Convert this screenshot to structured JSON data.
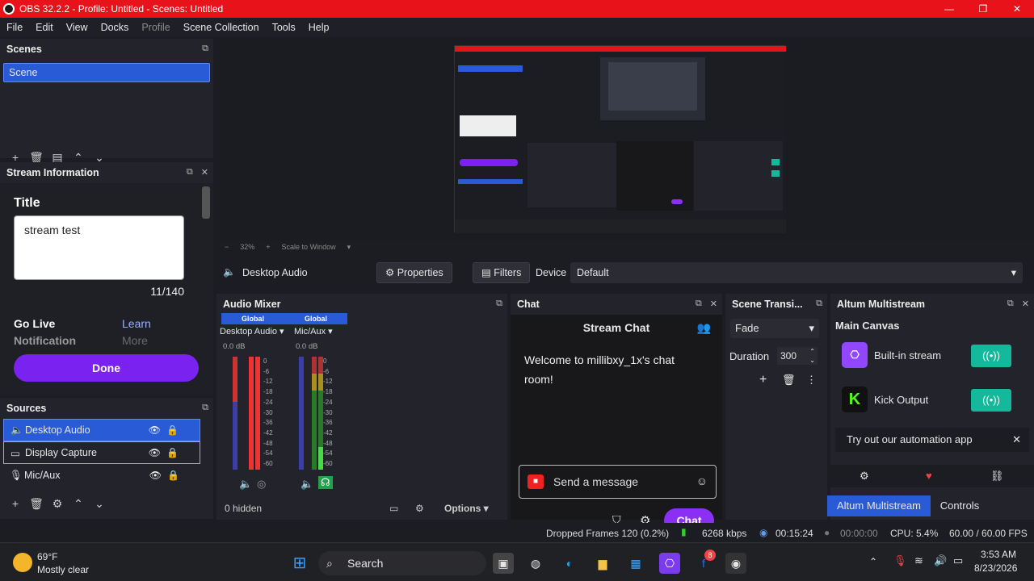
{
  "window": {
    "title": "OBS 32.2.2 - Profile: Untitled - Scenes: Untitled",
    "controls": [
      "—",
      "❐",
      "✕"
    ]
  },
  "menu": [
    "File",
    "Edit",
    "View",
    "Docks",
    "Profile",
    "Scene Collection",
    "Tools",
    "Help"
  ],
  "scenes": {
    "title": "Scenes",
    "items": [
      "Scene"
    ]
  },
  "stream_info": {
    "title": "Stream Information",
    "field_label": "Title",
    "field_value": "stream test",
    "counter": "11/140",
    "go_live_line1": "Go Live",
    "go_live_line2": "Notification",
    "learn_line1": "Learn",
    "learn_line2": "More",
    "done": "Done"
  },
  "sources": {
    "title": "Sources",
    "items": [
      {
        "label": "Desktop Audio"
      },
      {
        "label": "Display Capture"
      },
      {
        "label": "Mic/Aux"
      }
    ]
  },
  "preview": {
    "zoom": "32%",
    "scale": "Scale to Window"
  },
  "controls": {
    "source_name": "Desktop Audio",
    "properties": "Properties",
    "filters": "Filters",
    "device_label": "Device",
    "device_value": "Default"
  },
  "mixer": {
    "title": "Audio Mixer",
    "channels": [
      {
        "badge": "Global",
        "name": "Desktop Audio",
        "db": "0.0 dB"
      },
      {
        "badge": "Global",
        "name": "Mic/Aux",
        "db": "0.0 dB"
      }
    ],
    "scale": [
      "0",
      "-6",
      "-12",
      "-18",
      "-24",
      "-30",
      "-36",
      "-42",
      "-48",
      "-54",
      "-60"
    ],
    "hidden": "0 hidden",
    "options": "Options"
  },
  "chat": {
    "title": "Chat",
    "header": "Stream Chat",
    "welcome": "Welcome to millibxy_1x's chat room!",
    "placeholder": "Send a message",
    "button": "Chat"
  },
  "transitions": {
    "title": "Scene Transi...",
    "selected": "Fade",
    "duration_label": "Duration",
    "duration_value": "300"
  },
  "multistream": {
    "title": "Altum Multistream",
    "canvas": "Main Canvas",
    "outputs": [
      {
        "name": "Built-in stream",
        "color": "#9146ff"
      },
      {
        "name": "Kick Output",
        "color": "#53fc18"
      }
    ],
    "promo": "Try out our automation app",
    "tabs": [
      "Altum Multistream",
      "Controls"
    ]
  },
  "status": {
    "dropped": "Dropped Frames 120 (0.2%)",
    "kbps": "6268 kbps",
    "live_time": "00:15:24",
    "rec_time": "00:00:00",
    "cpu": "CPU: 5.4%",
    "fps": "60.00 / 60.00 FPS"
  },
  "taskbar": {
    "temp": "69°F",
    "weather": "Mostly clear",
    "search": "Search",
    "badge": "8",
    "time": "3:53 AM",
    "date": "8/23/2026"
  }
}
